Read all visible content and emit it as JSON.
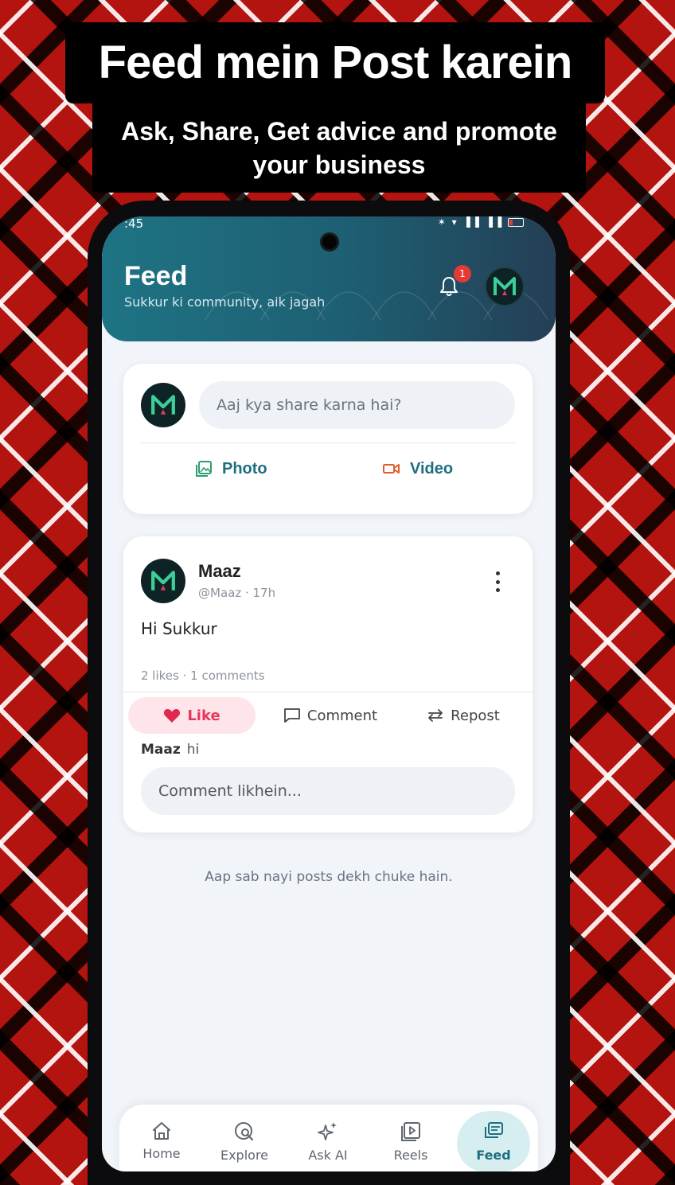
{
  "promo": {
    "title": "Feed mein Post karein",
    "subtitle_line1": "Ask, Share, Get advice and promote",
    "subtitle_line2": "your business"
  },
  "status_bar": {
    "time": ":45",
    "icons": "✶ ▾ ▐▐ ▐▐"
  },
  "header": {
    "title": "Feed",
    "subtitle": "Sukkur ki community, aik jagah",
    "notification_count": "1"
  },
  "composer": {
    "placeholder": "Aaj kya share karna hai?",
    "photo_label": "Photo",
    "video_label": "Video"
  },
  "post": {
    "author": "Maaz",
    "meta": "@Maaz · 17h",
    "text": "Hi Sukkur",
    "stats": "2 likes · 1 comments",
    "like_label": "Like",
    "comment_label": "Comment",
    "repost_label": "Repost",
    "comments": [
      {
        "author": "Maaz",
        "text": "hi"
      }
    ],
    "comment_placeholder": "Comment likhein..."
  },
  "feed_end_note": "Aap sab nayi posts dekh chuke hain.",
  "nav": {
    "items": [
      {
        "label": "Home",
        "icon": "home-icon"
      },
      {
        "label": "Explore",
        "icon": "explore-icon"
      },
      {
        "label": "Ask AI",
        "icon": "sparkle-icon"
      },
      {
        "label": "Reels",
        "icon": "reels-icon"
      },
      {
        "label": "Feed",
        "icon": "feed-icon",
        "active": true
      }
    ]
  },
  "colors": {
    "brand_teal": "#1d6f7f",
    "like_red": "#e8385c",
    "badge_red": "#e53935"
  }
}
